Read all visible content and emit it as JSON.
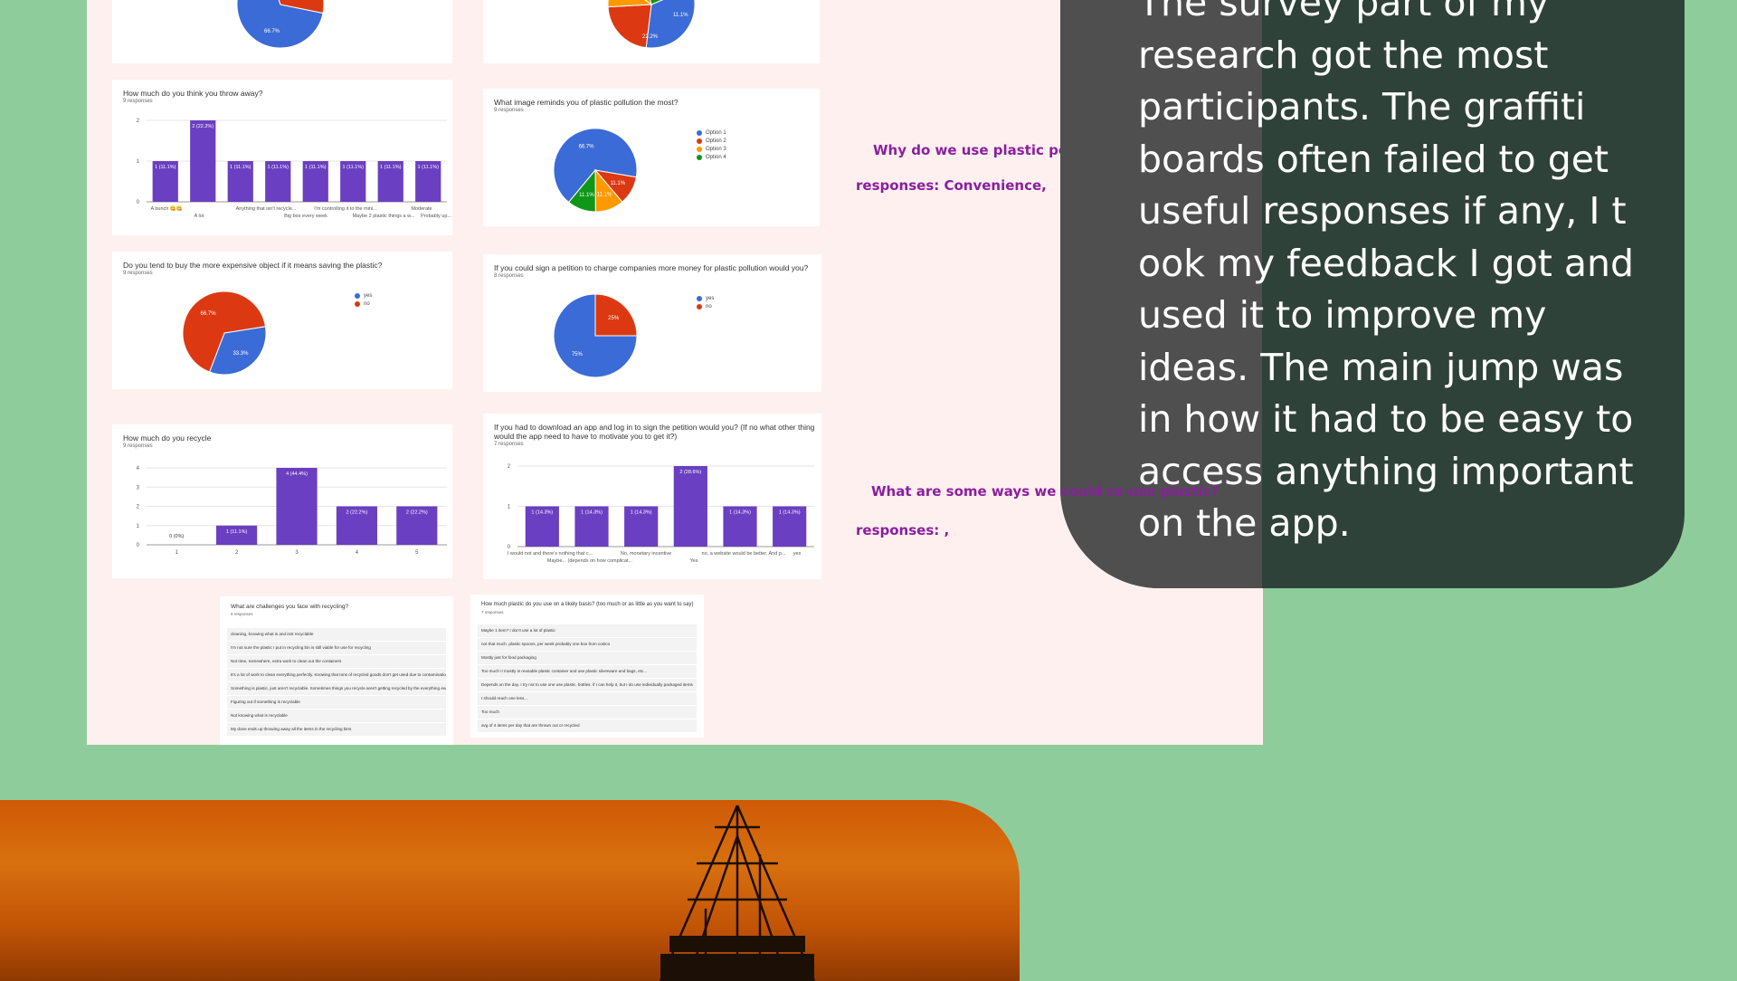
{
  "charts": {
    "pie_top_left": {
      "labels": [
        "66.7%"
      ],
      "colors": [
        "#3b6bd6",
        "#dc3912"
      ]
    },
    "pie_top_right": {
      "labels": [
        "22.2%",
        "11.1%"
      ],
      "colors": [
        "#dc3912",
        "#ff9900",
        "#109618",
        "#3b6bd6"
      ]
    },
    "throw_away": {
      "title": "How much do you think you throw away?",
      "responses": "9 responses",
      "y_ticks": [
        "0",
        "1",
        "2"
      ],
      "bars": [
        {
          "label": "1 (11.1%)",
          "value": 1
        },
        {
          "label": "2 (22.2%)",
          "value": 2
        },
        {
          "label": "1 (11.1%)",
          "value": 1
        },
        {
          "label": "1 (11.1%)",
          "value": 1
        },
        {
          "label": "1 (11.1%)",
          "value": 1
        },
        {
          "label": "1 (11.1%)",
          "value": 1
        },
        {
          "label": "1 (11.1%)",
          "value": 1
        },
        {
          "label": "1 (11.1%)",
          "value": 1
        }
      ],
      "x_labels_top": [
        "A bunch 😋😋",
        "Anything that isn't recycle...",
        "I'm controlling it to the mini...",
        "Moderate"
      ],
      "x_labels_bottom": [
        "A lot",
        "Big box every week",
        "Maybe 2 plastic things a w...",
        "Probably up..."
      ]
    },
    "image_pollution": {
      "title": "What image reminds you of plastic pollution the most?",
      "responses": "9 responses",
      "slice_labels": [
        "66.7%",
        "11.1%",
        "11.1%",
        "11.1%"
      ],
      "legend": [
        "Option 1",
        "Option 2",
        "Option 3",
        "Option 4"
      ],
      "colors": [
        "#3b6bd6",
        "#dc3912",
        "#ff9900",
        "#109618"
      ]
    },
    "expensive": {
      "title": "Do you tend to buy the more expensive object if it means saving the plastic?",
      "responses": "9 responses",
      "slice_labels": [
        "66.7%",
        "33.3%"
      ],
      "legend": [
        "yes",
        "no"
      ],
      "colors": [
        "#3b6bd6",
        "#dc3912"
      ]
    },
    "petition": {
      "title": "If you could sign a petition to charge companies more money for plastic pollution would you?",
      "responses": "8 responses",
      "slice_labels": [
        "75%",
        "25%"
      ],
      "legend": [
        "yes",
        "no"
      ],
      "colors": [
        "#3b6bd6",
        "#dc3912"
      ]
    },
    "recycle": {
      "title": "How much do you recycle",
      "responses": "9 responses",
      "y_ticks": [
        "0",
        "1",
        "2",
        "3",
        "4"
      ],
      "bars": [
        {
          "cat": "1",
          "label": "0 (0%)",
          "value": 0
        },
        {
          "cat": "2",
          "label": "1 (11.1%)",
          "value": 1
        },
        {
          "cat": "3",
          "label": "4 (44.4%)",
          "value": 4
        },
        {
          "cat": "4",
          "label": "2 (22.2%)",
          "value": 2
        },
        {
          "cat": "5",
          "label": "2 (22.2%)",
          "value": 2
        }
      ]
    },
    "app_petition": {
      "title": "If you had to download an app and log in to sign the petition would you? (If no what other thing",
      "title2": "would the app need to have to motivate you to get it?)",
      "responses": "7 responses",
      "y_ticks": [
        "0",
        "1",
        "2"
      ],
      "bars": [
        {
          "label": "1 (14.3%)",
          "value": 1
        },
        {
          "label": "1 (14.3%)",
          "value": 1
        },
        {
          "label": "1 (14.3%)",
          "value": 1
        },
        {
          "label": "2 (28.6%)",
          "value": 2
        },
        {
          "label": "1 (14.3%)",
          "value": 1
        },
        {
          "label": "1 (14.3%)",
          "value": 1
        }
      ],
      "x_labels_top": [
        "I would not and there's nothing that c...",
        "No, monetary incentive",
        "no, a website would be better. And p...",
        "yes"
      ],
      "x_labels_bottom": [
        "Maybe... (depends on how complicat...",
        "Yes"
      ]
    }
  },
  "challenges": {
    "title": "What are challenges you face with recycling?",
    "responses": "9 responses",
    "items": [
      "cleaning, knowing what is and isnt recyclable",
      "I'm not sure the plastic I put in recycling bin is still viable for use for recycling",
      "Not time, somewhere, extra work to clean out the containers",
      "It's a lot of work to clean everything perfectly. Knowing that tons of recycled goods don't get used due to contamination",
      "Something is plastic, just aren't recyclable. Sometimes things you recycle aren't getting recycled by the everything except tiny, recycled and are being shipped to developing countries",
      "Figuring out if something is recyclable",
      "Not knowing what is recyclable",
      "My done ends up throwing away all the items in the recycling bins"
    ]
  },
  "daily_plastic": {
    "title": "How much plastic do you use on a likely basis? (too much or as little as you want to say)",
    "responses": "7 responses",
    "items": [
      "Maybe 1 item? I don't use a lot of plastic",
      "not that much. plastic spoons, per week probably one box from costco",
      "Mostly just for food packaging",
      "Too much !! mostly in reusable plastic container and use plastic silverware and bags, etc...",
      "Depends on the day. I try not to use one use plastic. bottles. if I can help it, but I do use individually packaged items",
      "I should reach one less...",
      "Too much",
      "avg of 4 items per day that are thrown out or recycled"
    ]
  },
  "questions": {
    "q1": "Why do we use plastic pollution?",
    "r1": "responses: Convenience,",
    "q2": "What are some ways we could re-use plastic?",
    "r2": "responses: ,"
  },
  "panel": {
    "text": "The survey part of my\nresearch got the most\nparticipants. The graffiti\n boards often failed to get\nuseful responses if any, I t\nook my feedback I got and\nused it to improve my\nideas. The main jump was\nin how it had to be easy to\naccess anything important\non the app."
  },
  "colors": {
    "bar": "#6a3fc1",
    "background": "#8fcc9b",
    "panel": "#2f423a"
  }
}
